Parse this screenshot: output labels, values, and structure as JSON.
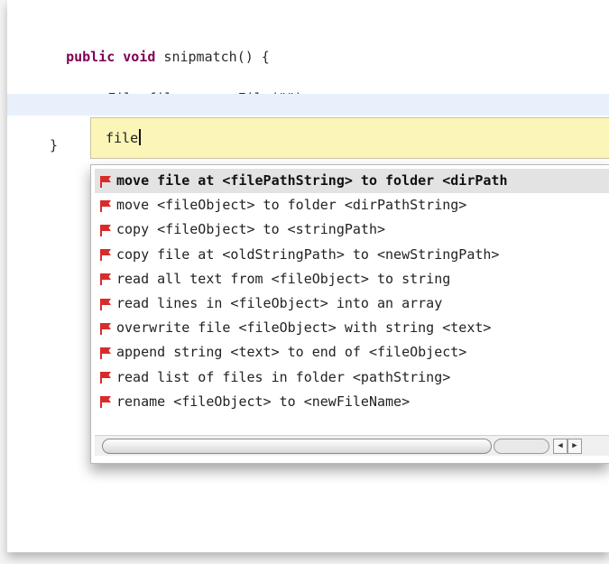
{
  "editor": {
    "method_modifiers": "public void",
    "method_rest": " snipmatch() {",
    "line2_type": "File",
    "line2_var": "file",
    "line2_assign": " = ",
    "line2_new": "new",
    "line2_ctor": " File(",
    "line2_string": "\"\"",
    "line2_end": ");",
    "closing_brace": "}"
  },
  "search": {
    "query": "file"
  },
  "popup": {
    "selected_index": 0,
    "items": [
      {
        "label": "move file at <filePathString> to folder <dirPath",
        "icon": "red-flag-icon"
      },
      {
        "label": "move <fileObject> to folder <dirPathString>",
        "icon": "red-flag-icon"
      },
      {
        "label": "copy <fileObject> to <stringPath>",
        "icon": "red-flag-icon"
      },
      {
        "label": "copy file at <oldStringPath> to <newStringPath>",
        "icon": "red-flag-icon"
      },
      {
        "label": "read all text from <fileObject> to string",
        "icon": "red-flag-icon"
      },
      {
        "label": "read lines in <fileObject> into an array",
        "icon": "red-flag-icon"
      },
      {
        "label": "overwrite file <fileObject> with string <text>",
        "icon": "red-flag-icon"
      },
      {
        "label": "append string <text> to end of <fileObject>",
        "icon": "red-flag-icon"
      },
      {
        "label": "read list of files in folder <pathString>",
        "icon": "red-flag-icon"
      },
      {
        "label": "rename <fileObject> to <newFileName>",
        "icon": "red-flag-icon"
      }
    ]
  },
  "colors": {
    "keyword": "#7f0055",
    "string": "#2a00ff",
    "search_bg": "#fbf6b8",
    "selection_bg": "#e3e3e3",
    "flag": "#d92b2b"
  }
}
